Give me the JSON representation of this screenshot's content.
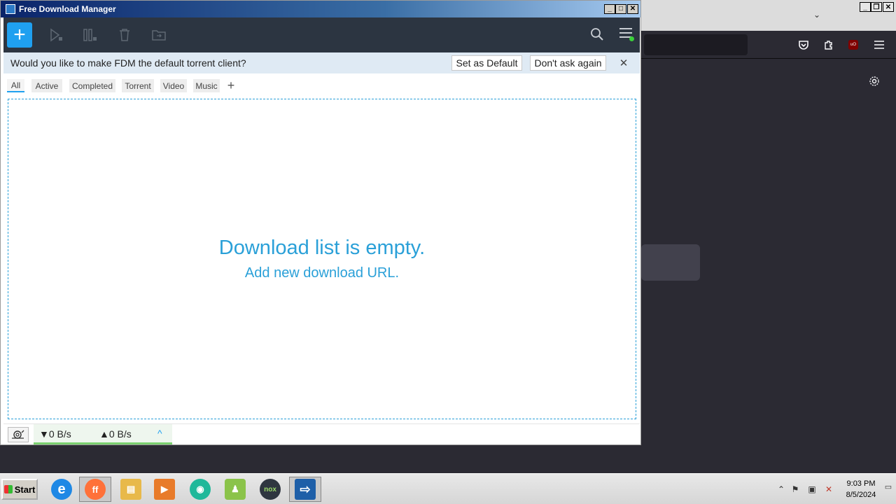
{
  "window": {
    "title": "Free Download Manager",
    "minimize_glyph": "_",
    "maximize_glyph": "□",
    "close_glyph": "✕"
  },
  "toolbar": {
    "add_glyph": "+",
    "icons": [
      "resume-icon",
      "pause-icon",
      "delete-icon",
      "move-folder-icon",
      "search-icon",
      "menu-icon"
    ]
  },
  "notification": {
    "message": "Would you like to make FDM the default torrent client?",
    "set_default_label": "Set as Default",
    "dont_ask_label": "Don't ask again",
    "close_glyph": "✕"
  },
  "tabs": [
    {
      "label": "All",
      "active": true
    },
    {
      "label": "Active",
      "active": false
    },
    {
      "label": "Completed",
      "active": false
    },
    {
      "label": "Torrent",
      "active": false
    },
    {
      "label": "Video",
      "active": false
    },
    {
      "label": "Music",
      "active": false
    }
  ],
  "tab_add_glyph": "+",
  "empty_state": {
    "title": "Download list is empty.",
    "subtitle": "Add new download URL."
  },
  "status": {
    "download_speed": "▼0 B/s",
    "upload_speed": "▲0 B/s",
    "toggle_glyph": "^"
  },
  "background_browser": {
    "ublock_label": "uO",
    "window_buttons": [
      "_",
      "❐",
      "✕"
    ]
  },
  "taskbar": {
    "start_label": "Start",
    "apps": [
      {
        "name": "internet-explorer-icon",
        "glyph": "e",
        "color": "#1e88e5"
      },
      {
        "name": "firefox-icon",
        "glyph": "ff",
        "color": "#ff7139"
      },
      {
        "name": "file-explorer-icon",
        "glyph": "▤",
        "color": "#e8b94a"
      },
      {
        "name": "media-player-icon",
        "glyph": "▶",
        "color": "#e87b2a"
      },
      {
        "name": "chat-app-icon",
        "glyph": "◉",
        "color": "#1fb89a"
      },
      {
        "name": "android-icon",
        "glyph": "♟",
        "color": "#8bc34a"
      },
      {
        "name": "nox-icon",
        "glyph": "nox",
        "color": "#2f3640"
      },
      {
        "name": "fdm-taskbar-icon",
        "glyph": "⇨",
        "color": "#1e5fa8"
      }
    ],
    "time": "9:03 PM",
    "date": "8/5/2024"
  }
}
